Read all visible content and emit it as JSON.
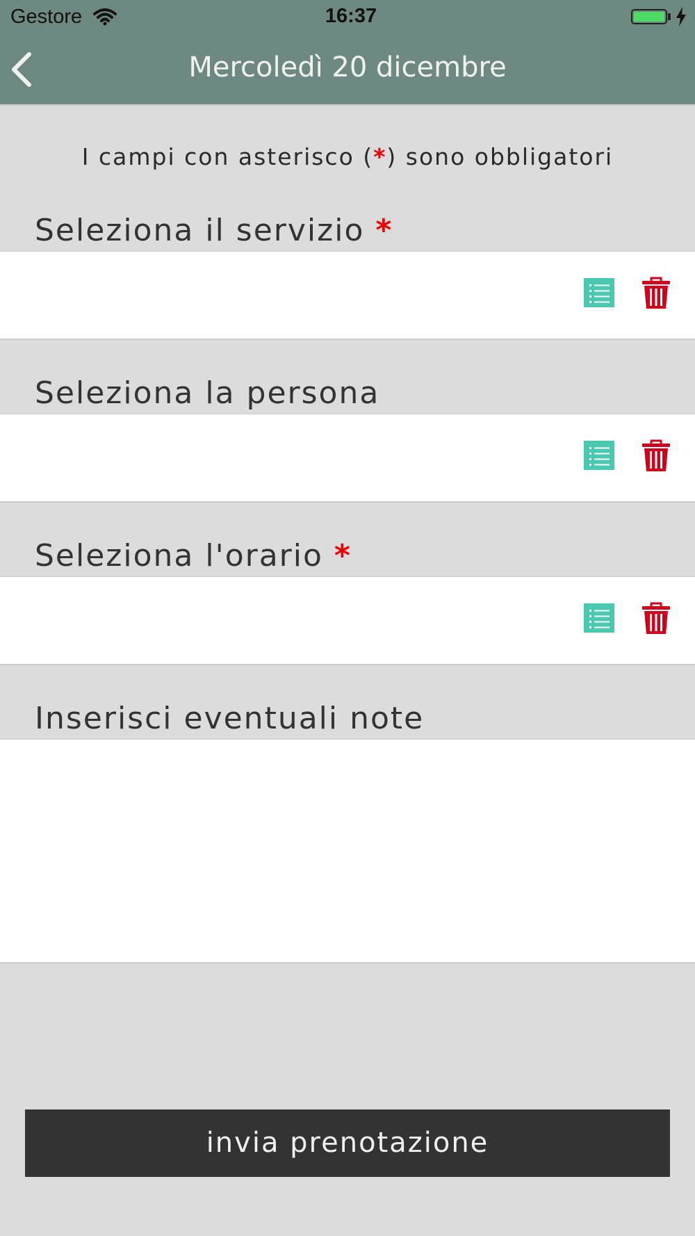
{
  "status_bar": {
    "carrier": "Gestore",
    "time": "16:37",
    "battery_level": 1.0
  },
  "header": {
    "title": "Mercoledì 20 dicembre",
    "background_color": "#6e8882"
  },
  "notice": {
    "before": "I campi con asterisco (",
    "asterisk": "*",
    "after": ") sono obbligatori"
  },
  "fields": [
    {
      "label": "Seleziona il servizio",
      "required_mark": "*"
    },
    {
      "label": "Seleziona la persona",
      "required_mark": ""
    },
    {
      "label": "Seleziona l'orario",
      "required_mark": "*"
    },
    {
      "label": "Inserisci eventuali note",
      "required_mark": ""
    }
  ],
  "icons": {
    "list": "list-icon",
    "trash": "trash-icon",
    "back": "chevron-left-icon"
  },
  "colors": {
    "accent_list": "#48c9b0",
    "delete": "#d0021b",
    "required": "#ee0000",
    "submit_bg": "#333333"
  },
  "submit": {
    "label": "invia prenotazione"
  }
}
